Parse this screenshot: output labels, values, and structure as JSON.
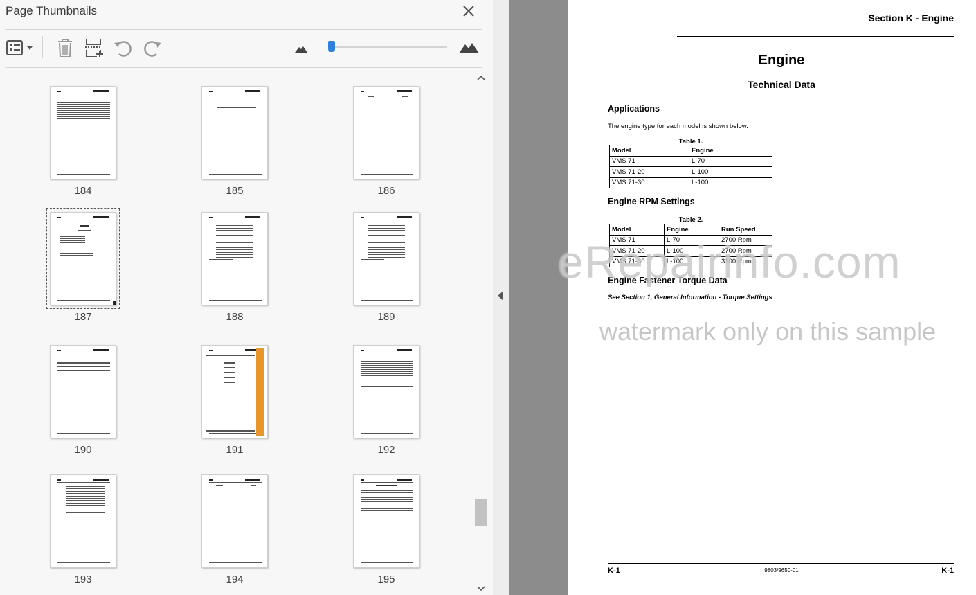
{
  "panel": {
    "title": "Page Thumbnails",
    "icons": {
      "close": "close-icon",
      "options": "page-options-icon",
      "delete": "delete-page-icon",
      "insert": "insert-page-icon",
      "rotate_ccw": "rotate-counterclockwise-icon",
      "rotate_cw": "rotate-clockwise-icon",
      "zoom_out": "small-mountain-icon",
      "zoom_in": "large-mountain-icon"
    },
    "zoom_level_fraction": 0.0
  },
  "thumbnails": [
    {
      "page": "184"
    },
    {
      "page": "185"
    },
    {
      "page": "186"
    },
    {
      "page": "187",
      "selected": true
    },
    {
      "page": "188"
    },
    {
      "page": "189"
    },
    {
      "page": "190"
    },
    {
      "page": "191"
    },
    {
      "page": "192"
    },
    {
      "page": "193"
    },
    {
      "page": "194"
    },
    {
      "page": "195"
    }
  ],
  "document": {
    "section_header": "Section K - Engine",
    "title": "Engine",
    "subtitle": "Technical Data",
    "applications_heading": "Applications",
    "applications_text": "The engine type for each model is shown below.",
    "table1": {
      "caption": "Table 1.",
      "headers": [
        "Model",
        "Engine"
      ],
      "rows": [
        [
          "VMS 71",
          "L-70"
        ],
        [
          "VMS 71-20",
          "L-100"
        ],
        [
          "VMS 71-30",
          "L-100"
        ]
      ]
    },
    "rpm_heading": "Engine RPM Settings",
    "table2": {
      "caption": "Table 2.",
      "headers": [
        "Model",
        "Engine",
        "Run Speed"
      ],
      "rows": [
        [
          "VMS 71",
          "L-70",
          "2700 Rpm"
        ],
        [
          "VMS 71-20",
          "L-100",
          "2700 Rpm"
        ],
        [
          "VMS 71-30",
          "L-100",
          "3100 Rpm"
        ]
      ]
    },
    "torque_heading": "Engine Fastener Torque Data",
    "torque_text": "See Section 1, General Information - Torque Settings",
    "footer_left": "K-1",
    "footer_center": "9803/9650-01",
    "footer_right": "K-1"
  },
  "watermark": {
    "line1": "eRepairinfo.com",
    "line2": "watermark only on this sample"
  }
}
